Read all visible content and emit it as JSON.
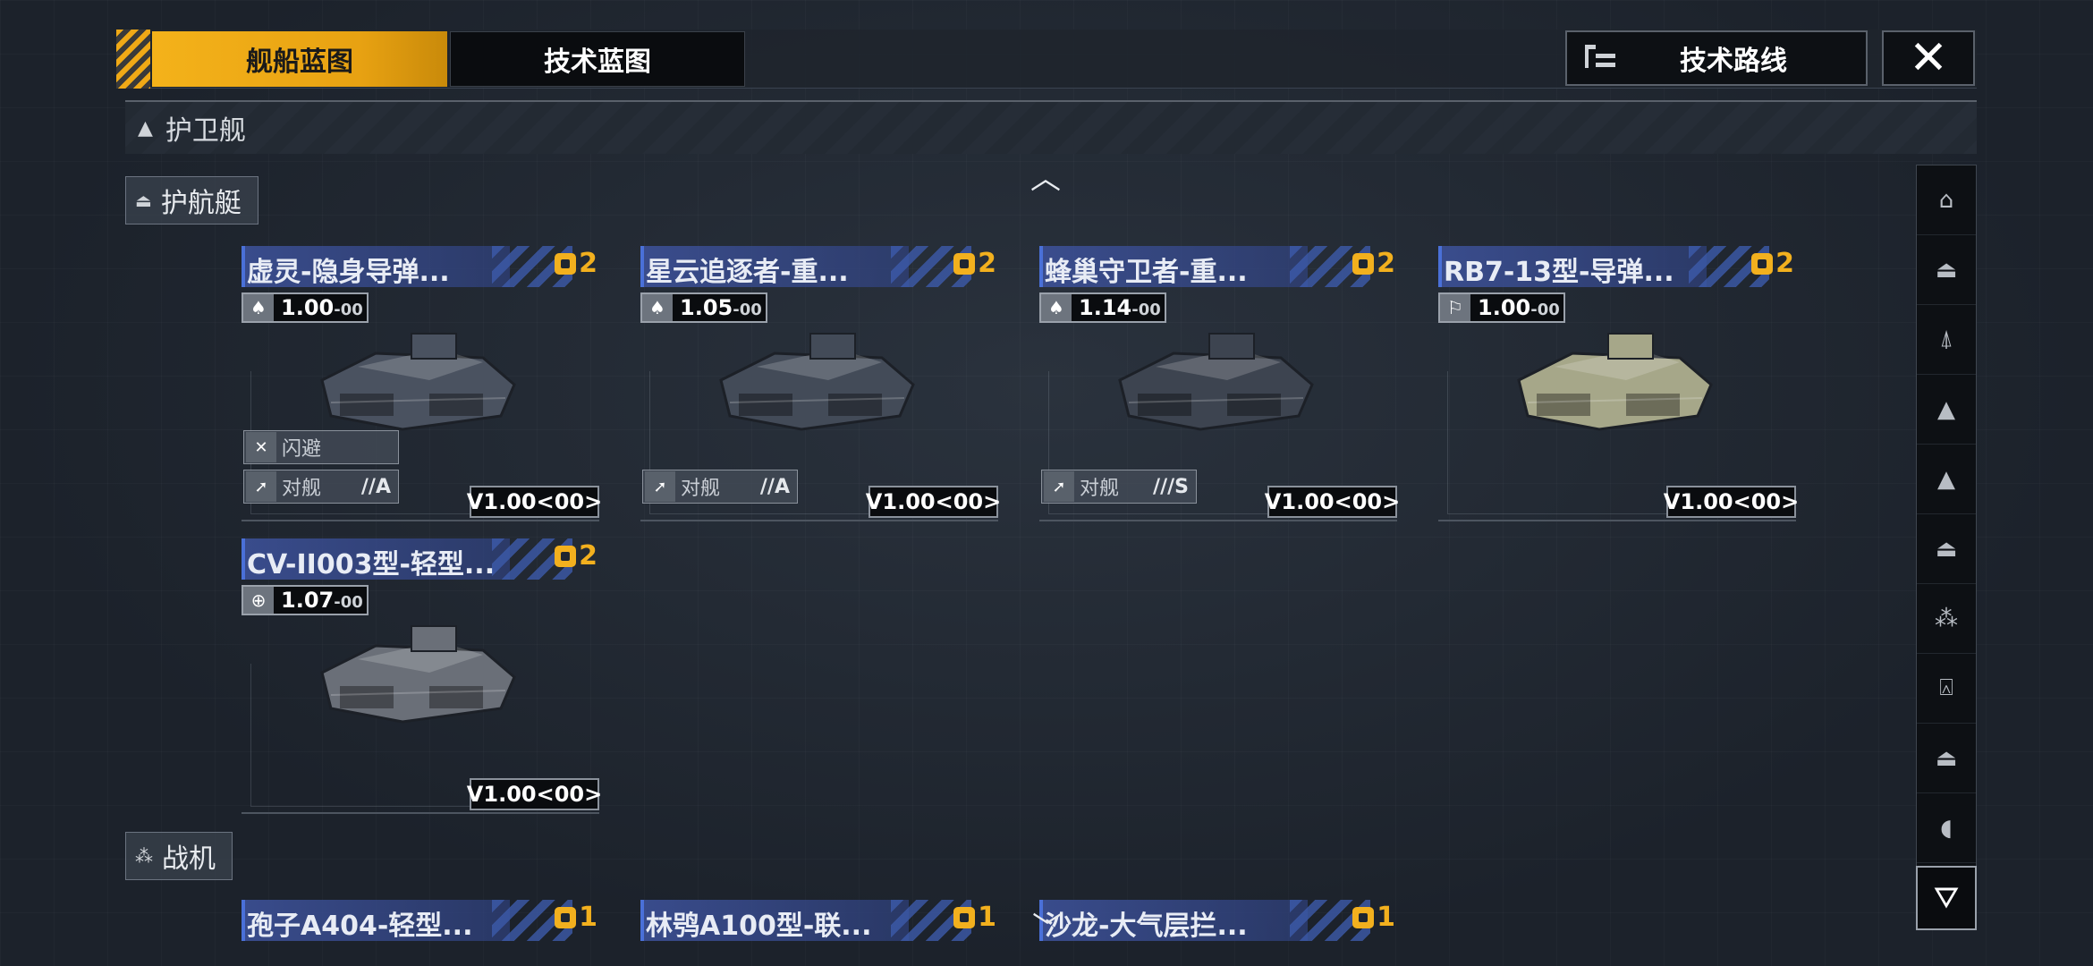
{
  "tabs": {
    "ship_blueprint": "舰船蓝图",
    "tech_blueprint": "技术蓝图"
  },
  "tech_route": {
    "label": "技术路线"
  },
  "close": {
    "glyph": "✕"
  },
  "category": {
    "label": "护卫舰"
  },
  "sections": {
    "escort": {
      "label": "护航艇"
    },
    "fighter": {
      "label": "战机"
    }
  },
  "ships": [
    {
      "name": "虚灵-隐身导弹...",
      "count": "2",
      "score_main": "1.00",
      "score_sub": "-00",
      "score_icon": "rocket-icon",
      "tags": [
        {
          "label": "闪避",
          "rank": ""
        },
        {
          "label": "对舰",
          "rank": "//A"
        }
      ],
      "version": "V1.00<00>",
      "hull": "#4a5260"
    },
    {
      "name": "星云追逐者-重...",
      "count": "2",
      "score_main": "1.05",
      "score_sub": "-00",
      "score_icon": "rocket-icon",
      "tags": [
        {
          "label": "对舰",
          "rank": "//A"
        }
      ],
      "version": "V1.00<00>",
      "hull": "#434b58"
    },
    {
      "name": "蜂巢守卫者-重...",
      "count": "2",
      "score_main": "1.14",
      "score_sub": "-00",
      "score_icon": "rocket-icon",
      "tags": [
        {
          "label": "对舰",
          "rank": "///S"
        }
      ],
      "version": "V1.00<00>",
      "hull": "#3d4450"
    },
    {
      "name": "RB7-13型-导弹...",
      "count": "2",
      "score_main": "1.00",
      "score_sub": "-00",
      "score_icon": "brand-icon",
      "tags": [],
      "version": "V1.00<00>",
      "hull": "#a6a789"
    },
    {
      "name": "CV-II003型-轻型...",
      "count": "2",
      "score_main": "1.07",
      "score_sub": "-00",
      "score_icon": "globe-icon",
      "tags": [],
      "version": "V1.00<00>",
      "hull": "#6a6f78"
    }
  ],
  "fighters": [
    {
      "name": "孢子A404-轻型...",
      "count": "1"
    },
    {
      "name": "林鸮A100型-联...",
      "count": "1"
    },
    {
      "name": "沙龙-大气层拦...",
      "count": "1"
    }
  ],
  "sidebar_icons": [
    "carrier-icon",
    "destroyer-icon",
    "frigate-icon",
    "corvette-icon",
    "escort-icon",
    "escort-boat-icon",
    "fighter-icon",
    "base-icon",
    "cruiser-icon",
    "battleship-icon"
  ],
  "filter": {
    "glyph": "⛛"
  },
  "colors": {
    "accent": "#f4b21a",
    "name_bar": "#3c5096",
    "count": "#f2b01e"
  }
}
